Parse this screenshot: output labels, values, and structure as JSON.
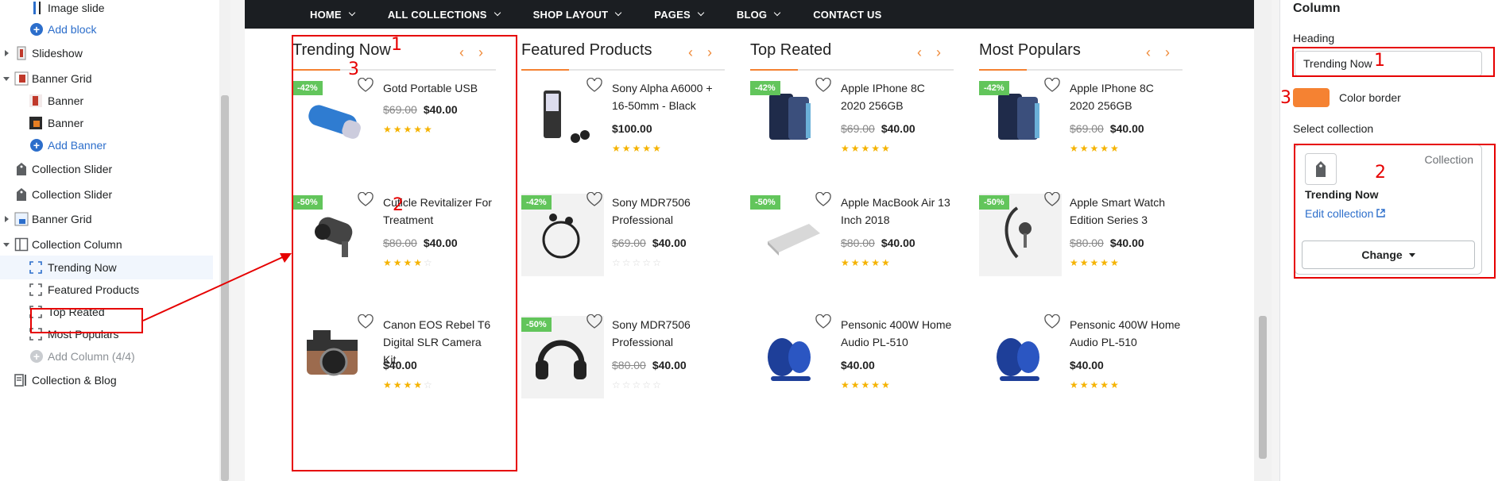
{
  "sidebar": {
    "items": [
      {
        "label": "Image slide"
      },
      {
        "label": "Add block"
      },
      {
        "label": "Slideshow"
      },
      {
        "label": "Banner Grid"
      },
      {
        "label": "Banner"
      },
      {
        "label": "Banner"
      },
      {
        "label": "Add Banner"
      },
      {
        "label": "Collection Slider"
      },
      {
        "label": "Collection Slider"
      },
      {
        "label": "Banner Grid"
      },
      {
        "label": "Collection Column"
      },
      {
        "label": "Trending Now"
      },
      {
        "label": "Featured Products"
      },
      {
        "label": "Top Reated"
      },
      {
        "label": "Most Populars"
      },
      {
        "label": "Add Column (4/4)"
      },
      {
        "label": "Collection & Blog"
      }
    ]
  },
  "nav": {
    "items": [
      {
        "label": "HOME"
      },
      {
        "label": "ALL COLLECTIONS"
      },
      {
        "label": "SHOP LAYOUT"
      },
      {
        "label": "PAGES"
      },
      {
        "label": "BLOG"
      },
      {
        "label": "CONTACT US"
      }
    ]
  },
  "columns": [
    {
      "title": "Trending Now",
      "products": [
        {
          "name": "Gotd Portable USB",
          "old": "$69.00",
          "price": "$40.00",
          "badge": "-42%",
          "stars": 5,
          "image": "usb-icon"
        },
        {
          "name": "Cuticle Revitalizer For Treatment",
          "old": "$80.00",
          "price": "$40.00",
          "badge": "-50%",
          "stars": 4,
          "image": "camera-security-icon"
        },
        {
          "name": "Canon EOS Rebel T6 Digital SLR Camera Kit",
          "old": "",
          "price": "$40.00",
          "badge": "",
          "stars": 4,
          "image": "camera-icon"
        }
      ]
    },
    {
      "title": "Featured Products",
      "products": [
        {
          "name": "Sony Alpha A6000 + 16-50mm - Black",
          "old": "",
          "price": "$100.00",
          "badge": "",
          "stars": 4.5,
          "image": "music-player-icon"
        },
        {
          "name": "Sony MDR7506 Professional",
          "old": "$69.00",
          "price": "$40.00",
          "badge": "-42%",
          "stars": 0,
          "image": "earphones-icon"
        },
        {
          "name": "Sony MDR7506 Professional",
          "old": "$80.00",
          "price": "$40.00",
          "badge": "-50%",
          "stars": 0,
          "image": "headphones-icon"
        }
      ]
    },
    {
      "title": "Top Reated",
      "products": [
        {
          "name": "Apple IPhone 8C 2020 256GB",
          "old": "$69.00",
          "price": "$40.00",
          "badge": "-42%",
          "stars": 5,
          "image": "phone-icon"
        },
        {
          "name": "Apple MacBook Air 13 Inch 2018",
          "old": "$80.00",
          "price": "$40.00",
          "badge": "-50%",
          "stars": 5,
          "image": "laptop-icon"
        },
        {
          "name": "Pensonic 400W Home Audio PL-510",
          "old": "",
          "price": "$40.00",
          "badge": "",
          "stars": 5,
          "image": "speaker-icon"
        }
      ]
    },
    {
      "title": "Most Populars",
      "products": [
        {
          "name": "Apple IPhone 8C 2020 256GB",
          "old": "$69.00",
          "price": "$40.00",
          "badge": "-42%",
          "stars": 5,
          "image": "phone-icon"
        },
        {
          "name": "Apple Smart Watch Edition Series 3",
          "old": "$80.00",
          "price": "$40.00",
          "badge": "-50%",
          "stars": 5,
          "image": "earbud-icon"
        },
        {
          "name": "Pensonic 400W Home Audio PL-510",
          "old": "",
          "price": "$40.00",
          "badge": "",
          "stars": 5,
          "image": "speaker-icon"
        }
      ]
    }
  ],
  "panel": {
    "title": "Column",
    "heading_label": "Heading",
    "heading_value": "Trending Now",
    "color_label": "Color border",
    "color_value": "#f58232",
    "select_label": "Select collection",
    "collection_tag": "Collection",
    "collection_name": "Trending Now",
    "edit_label": "Edit collection",
    "change_label": "Change"
  },
  "annotations": {
    "n1": "1",
    "n2": "2",
    "n3": "3"
  },
  "colors": {
    "accent": "#f08b3a",
    "badge": "#62c55b",
    "link": "#2c6ecb",
    "annotation": "#e60000",
    "nav": "#1b1e22"
  }
}
